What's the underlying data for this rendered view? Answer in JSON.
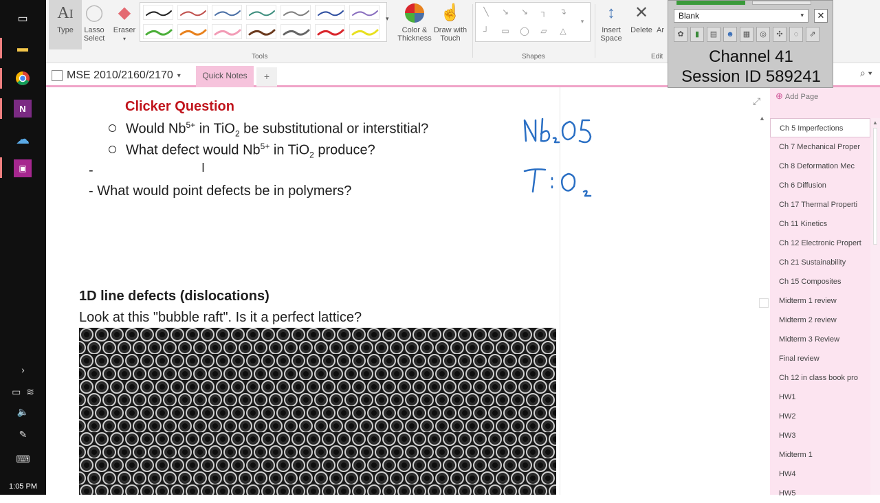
{
  "taskbar": {
    "clock": "1:05 PM"
  },
  "ribbon": {
    "type_label": "Type",
    "lasso_label_1": "Lasso",
    "lasso_label_2": "Select",
    "eraser_label": "Eraser",
    "color_label_1": "Color &",
    "color_label_2": "Thickness",
    "draw_label_1": "Draw with",
    "draw_label_2": "Touch",
    "insert_label_1": "Insert",
    "insert_label_2": "Space",
    "delete_label": "Delete",
    "arrange_label": "Ar",
    "tools_group": "Tools",
    "shapes_group": "Shapes",
    "edit_group": "Edit",
    "pen_colors": [
      "#222222",
      "#c0504d",
      "#4a6fa5",
      "#3e8e7e",
      "#7f7f7f",
      "#2f4fa0",
      "#8a6fbf",
      "#4caf3a",
      "#e8821e",
      "#f29cb6",
      "#6b3a1e",
      "#666666",
      "#d9262c",
      "#e8e020"
    ]
  },
  "float_panel": {
    "select_value": "Blank",
    "channel": "Channel 41",
    "session": "Session ID 589241"
  },
  "notebook": {
    "name": "MSE 2010/2160/2170",
    "tab": "Quick Notes"
  },
  "content": {
    "clicker_title": "Clicker Question",
    "q1_a": "Would Nb",
    "q1_sup": "5+",
    "q1_b": " in TiO",
    "q1_sub": "2",
    "q1_c": " be substitutional or interstitial?",
    "q2_a": "What defect would Nb",
    "q2_sup": "5+",
    "q2_b": " in TiO",
    "q2_sub": "2",
    "q2_c": " produce?",
    "dash_empty": "-",
    "q3": "-  What would point defects be in polymers?",
    "line_defects_title": "1D line defects (dislocations)",
    "bubble_raft_q": "Look at this \"bubble raft\". Is it a perfect lattice?"
  },
  "pages": {
    "add_page": "Add Page",
    "items": [
      "Ch 5 Imperfections",
      "Ch 7 Mechanical Proper",
      "Ch 8 Deformation Mec",
      "Ch 6 Diffusion",
      "Ch 17 Thermal Properti",
      "Ch 11 Kinetics",
      "Ch 12 Electronic Propert",
      "Ch 21 Sustainability",
      "Ch 15 Composites",
      "Midterm 1 review",
      "Midterm 2 review",
      "Midterm 3 Review",
      "Final review",
      "Ch 12 in class book pro",
      "HW1",
      "HW2",
      "HW3",
      "Midterm 1",
      "HW4",
      "HW5"
    ],
    "active_index": 0
  }
}
